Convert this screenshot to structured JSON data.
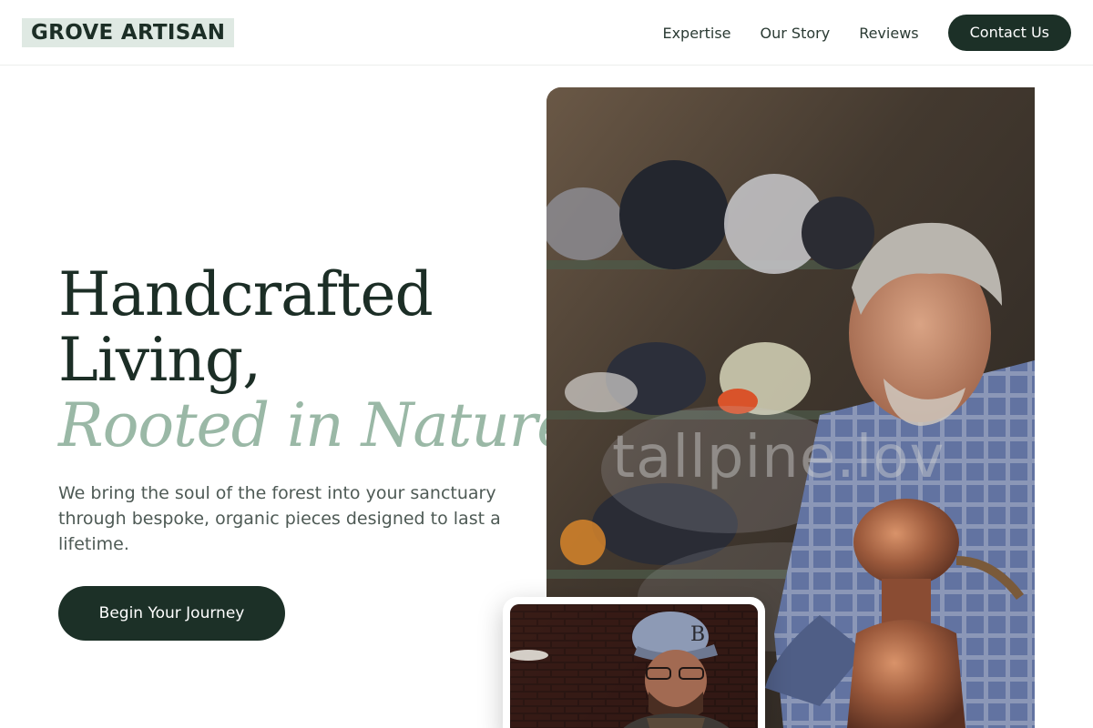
{
  "header": {
    "logo": "GROVE ARTISAN",
    "nav": [
      {
        "label": "Expertise"
      },
      {
        "label": "Our Story"
      },
      {
        "label": "Reviews"
      }
    ],
    "contact_label": "Contact Us"
  },
  "hero": {
    "title_line1": "Handcrafted",
    "title_line2": "Living,",
    "title_accent": "Rooted in Nature.",
    "description": "We bring the soul of the forest into your sanctuary through bespoke, organic pieces designed to last a lifetime.",
    "cta_label": "Begin Your Journey"
  },
  "images": {
    "main_watermark": "tallpine.lov"
  },
  "colors": {
    "primary": "#1c3027",
    "accent": "#9ab8a6",
    "logo_bg": "#dfe9e3"
  }
}
